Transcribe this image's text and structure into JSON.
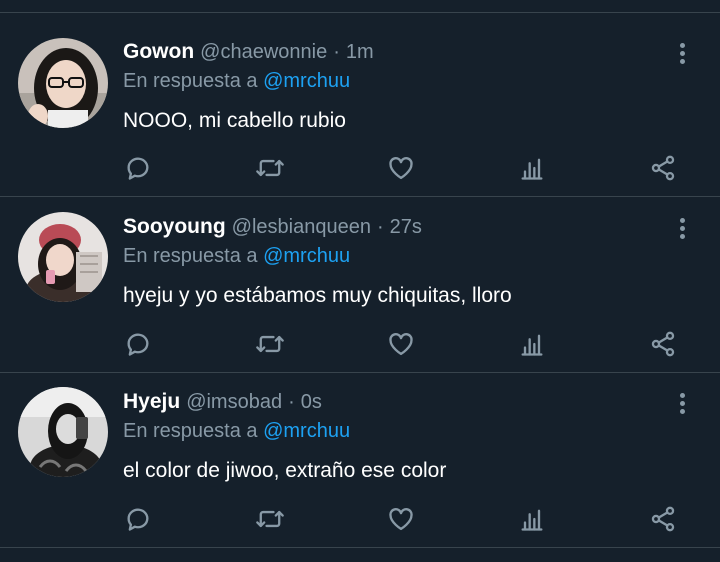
{
  "tweets": [
    {
      "name": "Gowon",
      "handle": "@chaewonnie",
      "time": "1m",
      "reply_prefix": "En respuesta a",
      "reply_to": "@mrchuu",
      "text": "NOOO, mi cabello rubio",
      "avatar_color": "#c9c1bb"
    },
    {
      "name": "Sooyoung",
      "handle": "@lesbianqueen",
      "time": "27s",
      "reply_prefix": "En respuesta a",
      "reply_to": "@mrchuu",
      "text": "hyeju y yo estábamos muy chiquitas, lloro",
      "avatar_color": "#e7e3e1"
    },
    {
      "name": "Hyeju",
      "handle": "@imsobad",
      "time": "0s",
      "reply_prefix": "En respuesta a",
      "reply_to": "@mrchuu",
      "text": "el color de jiwoo, extraño ese color",
      "avatar_color": "#d8d8d8"
    }
  ],
  "icons": [
    "reply-icon",
    "retweet-icon",
    "like-icon",
    "analytics-icon",
    "share-icon",
    "more-options-icon"
  ],
  "colors": {
    "background": "#15202b",
    "divider": "#38444d",
    "muted": "#8899a6",
    "link": "#1da1f2"
  }
}
